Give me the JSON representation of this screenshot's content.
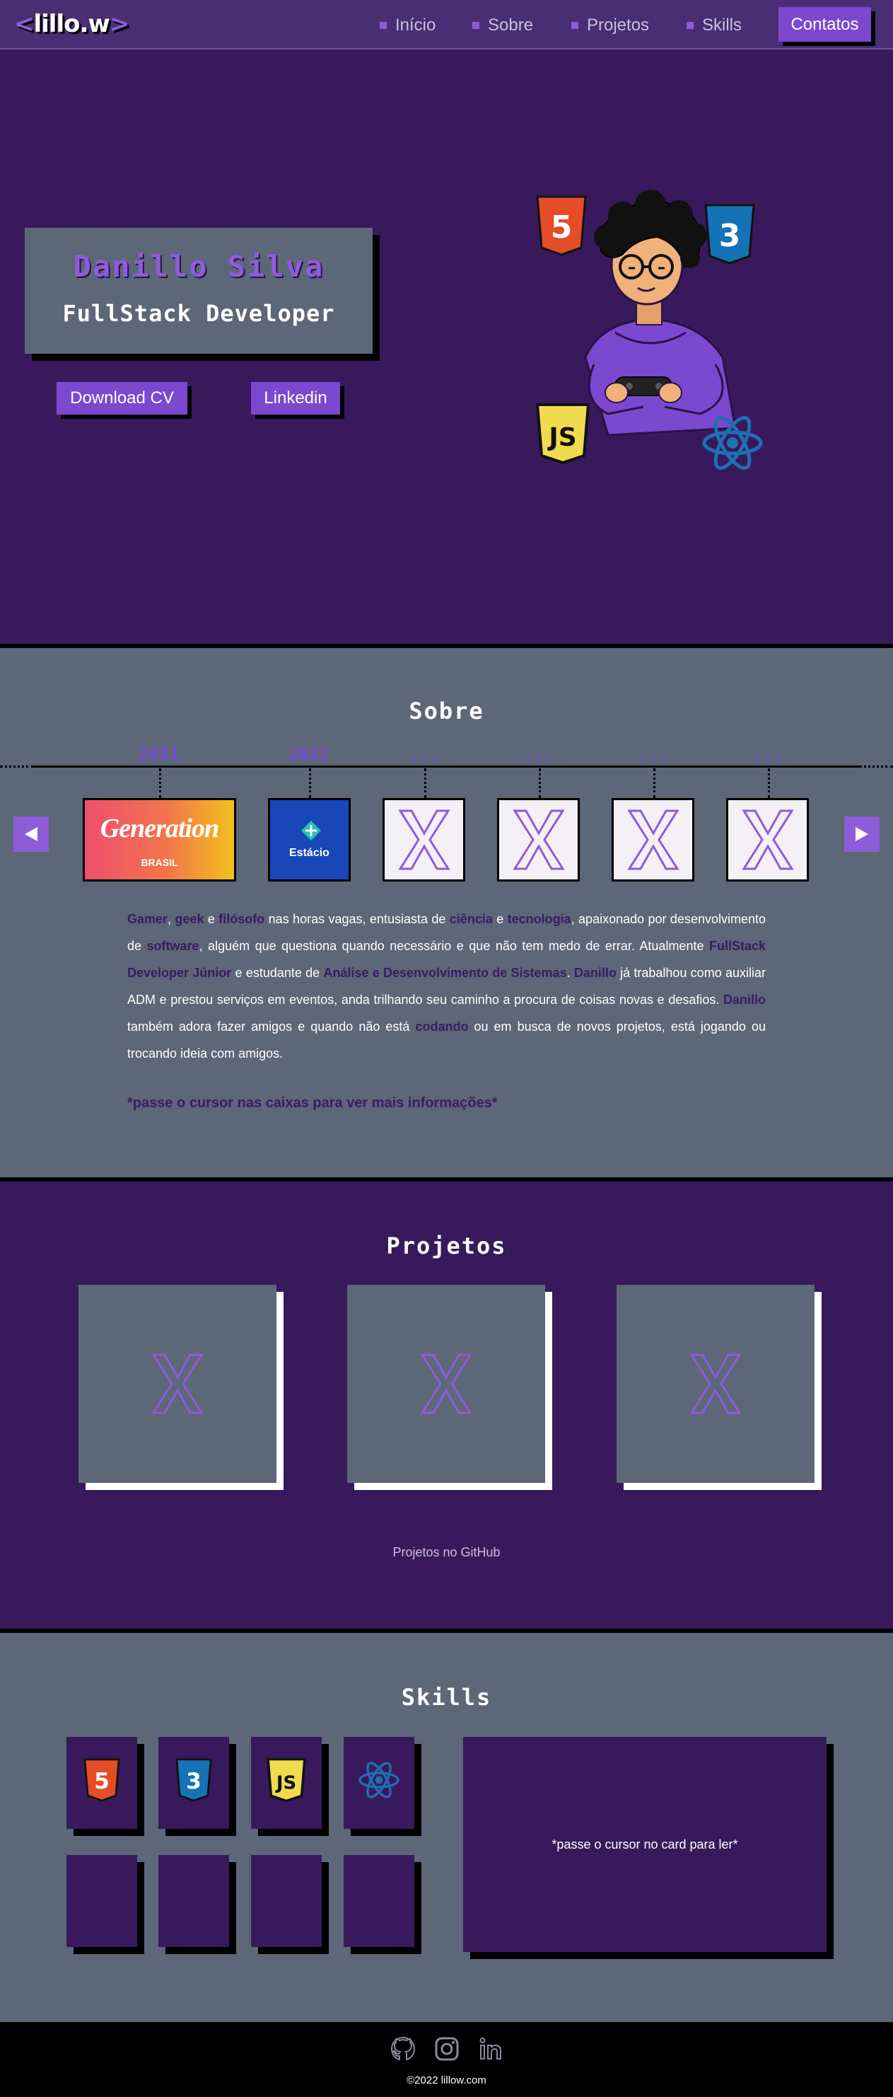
{
  "nav": {
    "logo_open": "<",
    "logo_text": "lillo.w",
    "logo_close": ">",
    "items": [
      {
        "label": "Início"
      },
      {
        "label": "Sobre"
      },
      {
        "label": "Projetos"
      },
      {
        "label": "Skills"
      }
    ],
    "contact_label": "Contatos"
  },
  "hero": {
    "name": "Danillo Silva",
    "role": "FullStack Developer",
    "download_label": "Download CV",
    "linkedin_label": "Linkedin",
    "badges": [
      "html5-icon",
      "css3-icon",
      "js-icon",
      "react-icon"
    ]
  },
  "about": {
    "title": "Sobre",
    "years": [
      "2021",
      "2022",
      "...",
      "...",
      "...",
      "..."
    ],
    "company_1_name": "Generation",
    "company_1_sub": "BRASIL",
    "company_2_name": "Estácio",
    "text": [
      {
        "t": "Gamer",
        "h": true
      },
      {
        "t": ", ",
        "h": false
      },
      {
        "t": "geek",
        "h": true
      },
      {
        "t": " e ",
        "h": false
      },
      {
        "t": "filósofo",
        "h": true
      },
      {
        "t": " nas horas vagas, entusiasta de ",
        "h": false
      },
      {
        "t": "ciência",
        "h": true
      },
      {
        "t": " e ",
        "h": false
      },
      {
        "t": "tecnologia",
        "h": true
      },
      {
        "t": ", apaixonado por desenvolvimento de ",
        "h": false
      },
      {
        "t": "software",
        "h": true
      },
      {
        "t": ", alguém que questiona quando necessário e que não tem medo de errar. Atualmente ",
        "h": false
      },
      {
        "t": "FullStack Developer Júnior",
        "h": true
      },
      {
        "t": " e estudante de ",
        "h": false
      },
      {
        "t": "Análise e Desenvolvimento de Sistemas",
        "h": true
      },
      {
        "t": ". ",
        "h": false
      },
      {
        "t": "Danillo",
        "h": true
      },
      {
        "t": " já trabalhou como auxiliar ADM e prestou serviços em eventos, anda trilhando seu caminho a procura de coisas novas e desafios. ",
        "h": false
      },
      {
        "t": "Danillo",
        "h": true
      },
      {
        "t": " também adora fazer amigos e quando não está ",
        "h": false
      },
      {
        "t": "codando",
        "h": true
      },
      {
        "t": " ou em busca de novos projetos, está jogando ou trocando ideia com amigos.",
        "h": false
      }
    ],
    "hint": "*passe o cursor nas caixas para ver mais informações*"
  },
  "projects": {
    "title": "Projetos",
    "github_link": "Projetos no GitHub"
  },
  "skills": {
    "title": "Skills",
    "icons": [
      "html5-icon",
      "css3-icon",
      "js-icon",
      "react-icon"
    ],
    "card_hint": "*passe o cursor no card para ler*"
  },
  "footer": {
    "icons": [
      "github-icon",
      "instagram-icon",
      "linkedin-icon"
    ],
    "copyright": "©2022 lillow.com"
  },
  "colors": {
    "bg_purple": "#381a5c",
    "nav_purple": "#4a2e74",
    "accent": "#7b48d0",
    "slate": "#5c6778"
  }
}
